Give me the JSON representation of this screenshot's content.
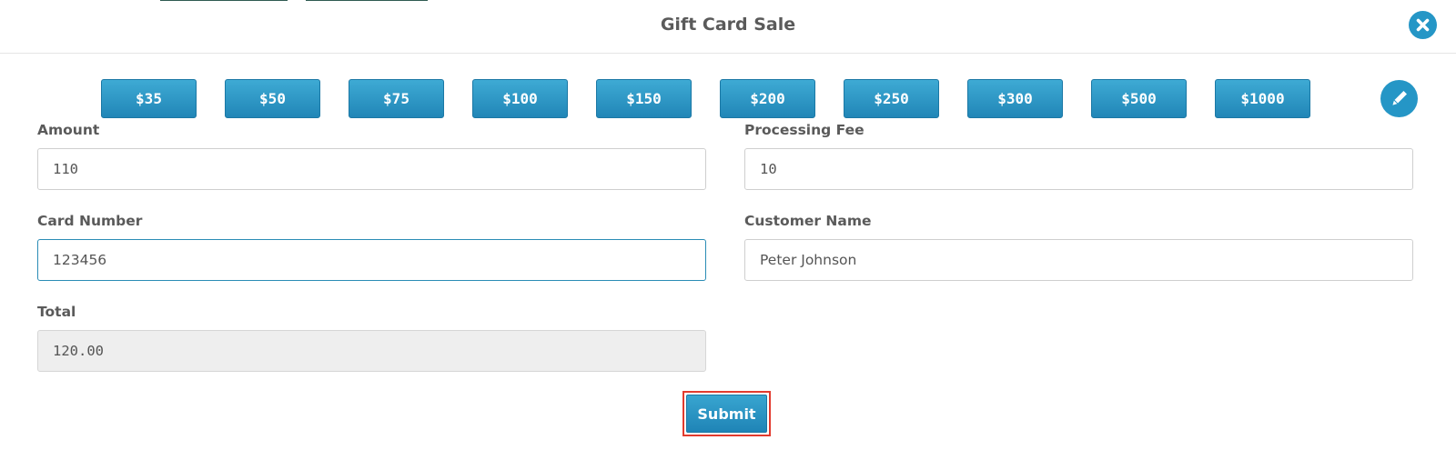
{
  "dialog": {
    "title": "Gift Card Sale"
  },
  "presets": [
    "$35",
    "$50",
    "$75",
    "$100",
    "$150",
    "$200",
    "$250",
    "$300",
    "$500",
    "$1000"
  ],
  "form": {
    "amount": {
      "label": "Amount",
      "value": "110"
    },
    "processing_fee": {
      "label": "Processing Fee",
      "value": "10"
    },
    "card_number": {
      "label": "Card Number",
      "value": "123456"
    },
    "customer_name": {
      "label": "Customer Name",
      "value": "Peter Johnson"
    },
    "total": {
      "label": "Total",
      "value": "120.00"
    }
  },
  "actions": {
    "submit_label": "Submit"
  },
  "icons": {
    "close": "close-circle-icon",
    "edit": "pencil-icon"
  },
  "colors": {
    "accent": "#2596c6",
    "highlight": "#e23b2e"
  }
}
